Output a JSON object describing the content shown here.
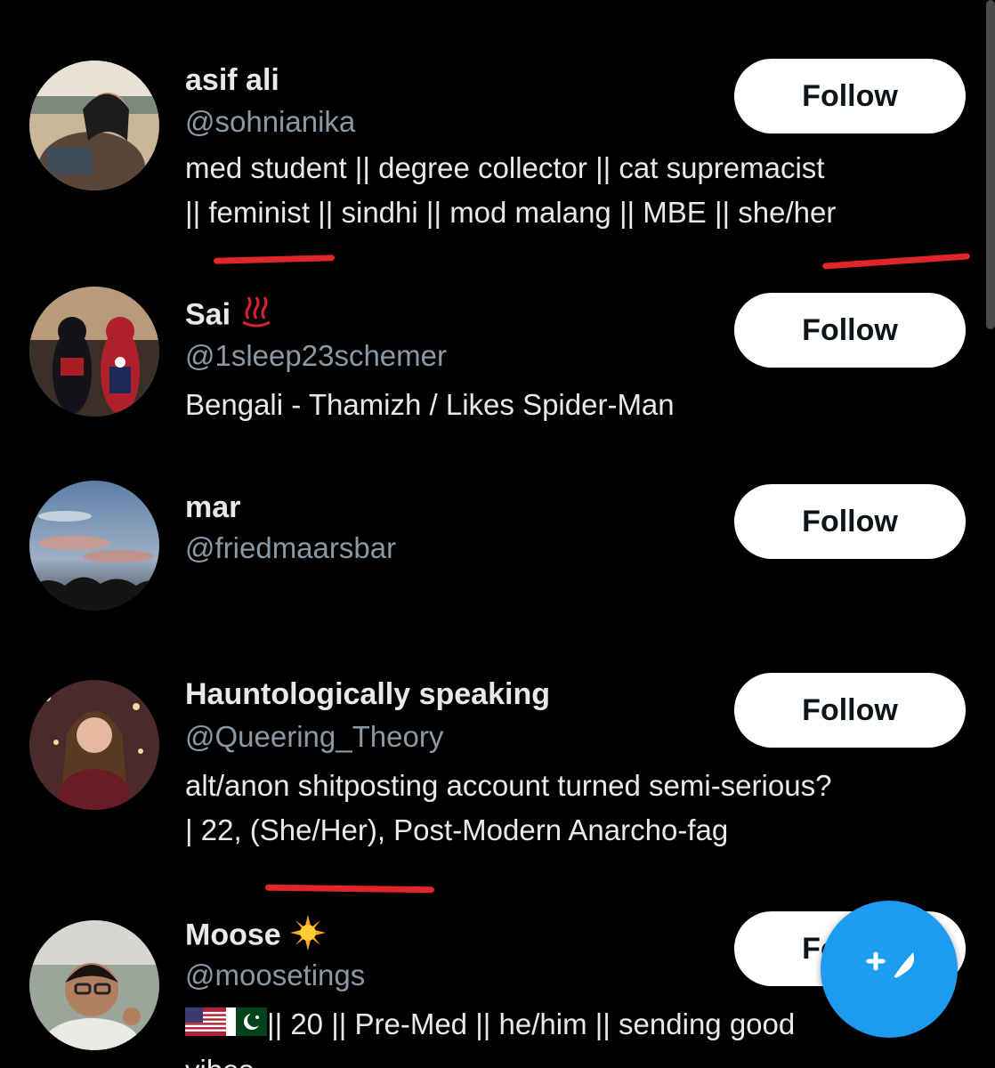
{
  "users": [
    {
      "name": "asif ali",
      "handle": "@sohnianika",
      "bio_lines": [
        "med student || degree collector || cat supremacist",
        "|| feminist || sindhi || mod malang || MBE || she/her"
      ],
      "follow_label": "Follow"
    },
    {
      "name": "Sai",
      "emoji": "♨️",
      "handle": "@1sleep23schemer",
      "bio_lines": [
        "Bengali - Thamizh / Likes Spider-Man"
      ],
      "follow_label": "Follow"
    },
    {
      "name": "mar",
      "handle": "@friedmaarsbar",
      "bio_lines": [],
      "follow_label": "Follow"
    },
    {
      "name": "Hauntologically speaking",
      "handle": "@Queering_Theory",
      "bio_lines": [
        "alt/anon shitposting account turned semi-serious?",
        "| 22, (She/Her), Post-Modern Anarcho-fag"
      ],
      "follow_label": "Follow"
    },
    {
      "name": "Moose",
      "emoji": "☀️",
      "handle": "@moosetings",
      "bio_lines": [
        "🇺🇸🇵🇰|| 20 || Pre-Med || he/him || sending good",
        "vibes"
      ],
      "bio_text_after_flags": "|| 20 || Pre-Med || he/him || sending good",
      "follow_label": "Follow"
    }
  ],
  "colors": {
    "background": "#000000",
    "name": "#e7e9ea",
    "handle": "#8b98a5",
    "button_bg": "#ffffff",
    "fab": "#1d9bf0",
    "annotation_underline": "#e0262a"
  },
  "icons": {
    "fab": "compose-tweet-icon"
  }
}
